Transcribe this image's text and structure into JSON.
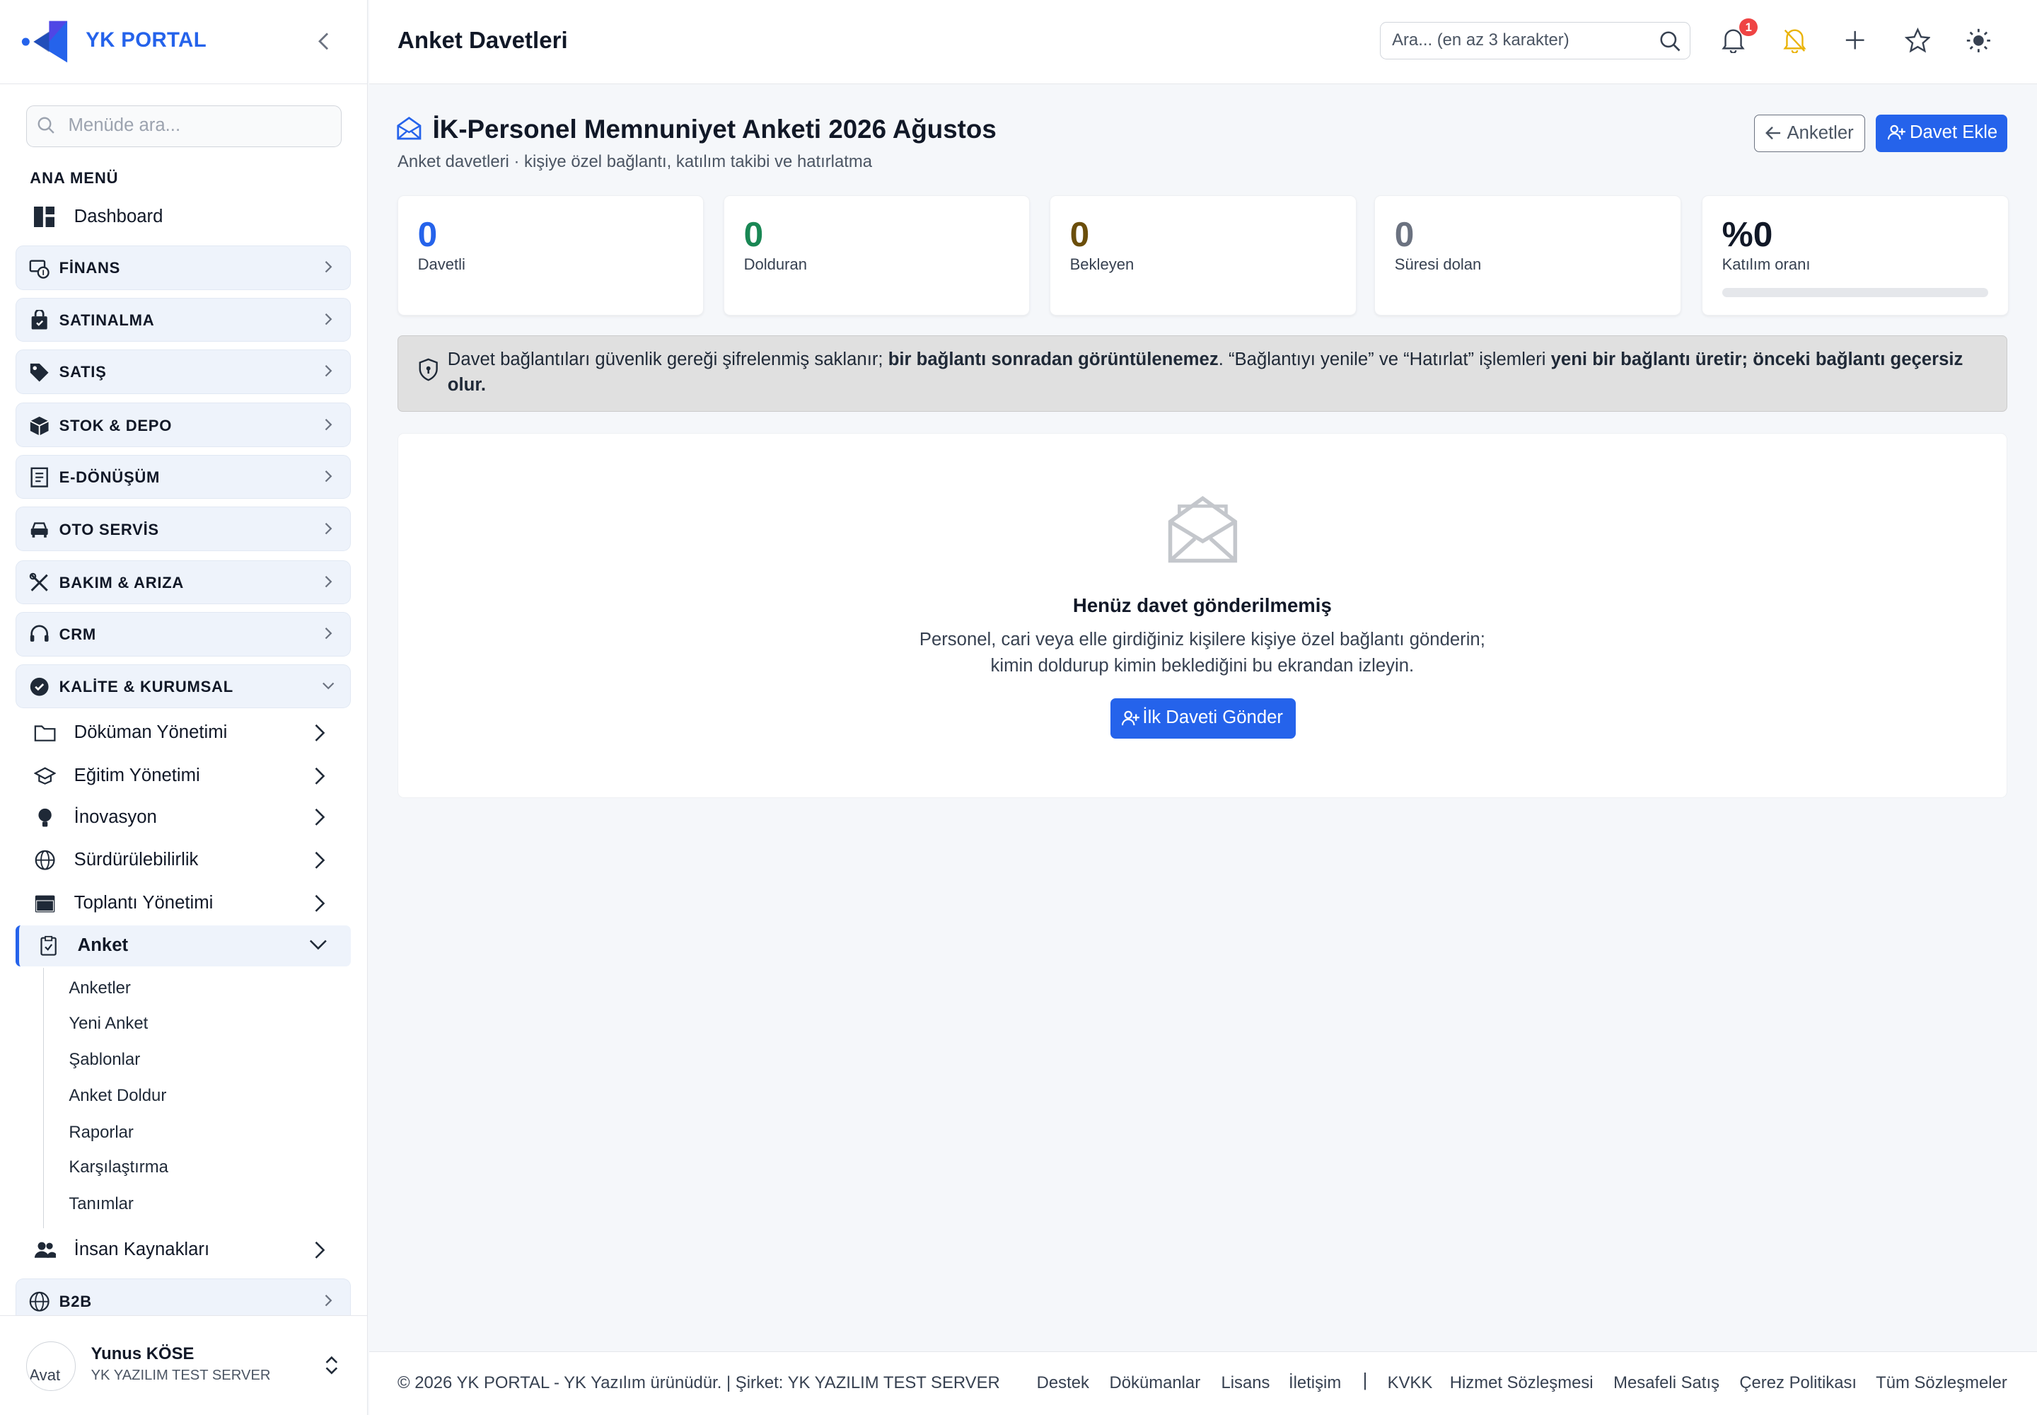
{
  "app": {
    "brand": "YK PORTAL"
  },
  "sidebar": {
    "search_placeholder": "Menüde ara...",
    "section_title": "ANA MENÜ",
    "dashboard": "Dashboard",
    "groups": [
      {
        "label": "FİNANS",
        "icon": "finance-icon"
      },
      {
        "label": "SATINALMA",
        "icon": "bag-icon"
      },
      {
        "label": "SATIŞ",
        "icon": "tag-icon"
      },
      {
        "label": "STOK & DEPO",
        "icon": "box-icon"
      },
      {
        "label": "E-DÖNÜŞÜM",
        "icon": "receipt-icon"
      },
      {
        "label": "OTO SERVİS",
        "icon": "car-icon"
      },
      {
        "label": "BAKIM & ARIZA",
        "icon": "tools-icon"
      },
      {
        "label": "CRM",
        "icon": "headset-icon"
      },
      {
        "label": "KALİTE & KURUMSAL",
        "icon": "patch-check-icon"
      }
    ],
    "kalite_items": [
      {
        "label": "Döküman Yönetimi",
        "icon": "folder-icon"
      },
      {
        "label": "Eğitim Yönetimi",
        "icon": "mortarboard-icon"
      },
      {
        "label": "İnovasyon",
        "icon": "lightbulb-icon"
      },
      {
        "label": "Sürdürülebilirlik",
        "icon": "globe-icon"
      },
      {
        "label": "Toplantı Yönetimi",
        "icon": "calendar-icon"
      },
      {
        "label": "Anket",
        "icon": "clipboard-check-icon"
      }
    ],
    "anket_items": [
      "Anketler",
      "Yeni Anket",
      "Şablonlar",
      "Anket Doldur",
      "Raporlar",
      "Karşılaştırma",
      "Tanımlar"
    ],
    "ik_item": {
      "label": "İnsan Kaynakları",
      "icon": "people-icon"
    },
    "b2b_group": {
      "label": "B2B",
      "icon": "globe-icon"
    },
    "user": {
      "name": "Yunus KÖSE",
      "company": "YK YAZILIM TEST SERVER",
      "avatar_alt": "Avat"
    }
  },
  "topbar": {
    "title": "Anket Davetleri",
    "search_placeholder": "Ara... (en az 3 karakter)",
    "notification_count": "1"
  },
  "page": {
    "title": "İK-Personel Memnuniyet Anketi 2026 Ağustos",
    "subtitle": "Anket davetleri · kişiye özel bağlantı, katılım takibi ve hatırlatma",
    "back_button": "Anketler",
    "add_button": "Davet Ekle"
  },
  "stats": [
    {
      "value": "0",
      "label": "Davetli",
      "color": "#2563eb"
    },
    {
      "value": "0",
      "label": "Dolduran",
      "color": "#198754"
    },
    {
      "value": "0",
      "label": "Bekleyen",
      "color": "#6b4e0a"
    },
    {
      "value": "0",
      "label": "Süresi dolan",
      "color": "#6b7280"
    },
    {
      "value": "%0",
      "label": "Katılım oranı",
      "color": "#111827",
      "progress": 0
    }
  ],
  "alert": {
    "t1": "Davet bağlantıları güvenlik gereği şifrelenmiş saklanır; ",
    "b1": "bir bağlantı sonradan görüntülenemez",
    "t2": ". “Bağlantıyı yenile” ve “Hatırlat” işlemleri ",
    "b2": "yeni bir bağlantı üretir; önceki bağlantı geçersiz olur."
  },
  "empty_state": {
    "title": "Henüz davet gönderilmemiş",
    "line1": "Personel, cari veya elle girdiğiniz kişilere kişiye özel bağlantı gönderin;",
    "line2": "kimin doldurup kimin beklediğini bu ekrandan izleyin.",
    "button": "İlk Daveti Gönder"
  },
  "footer": {
    "copyright": "© 2026 YK PORTAL - YK Yazılım ürünüdür. | Şirket: YK YAZILIM TEST SERVER",
    "links": [
      "Destek",
      "Dökümanlar",
      "Lisans",
      "İletişim"
    ],
    "separator": "|",
    "legal_links": [
      "KVKK",
      "Hizmet Sözleşmesi",
      "Mesafeli Satış",
      "Çerez Politikası",
      "Tüm Sözleşmeler"
    ]
  },
  "colors": {
    "accent": "#2563eb",
    "group_bg": "#eef3fb",
    "alert_bg": "#e0e0e0",
    "badge": "#ef4444",
    "bell_muted": "#eab308"
  }
}
